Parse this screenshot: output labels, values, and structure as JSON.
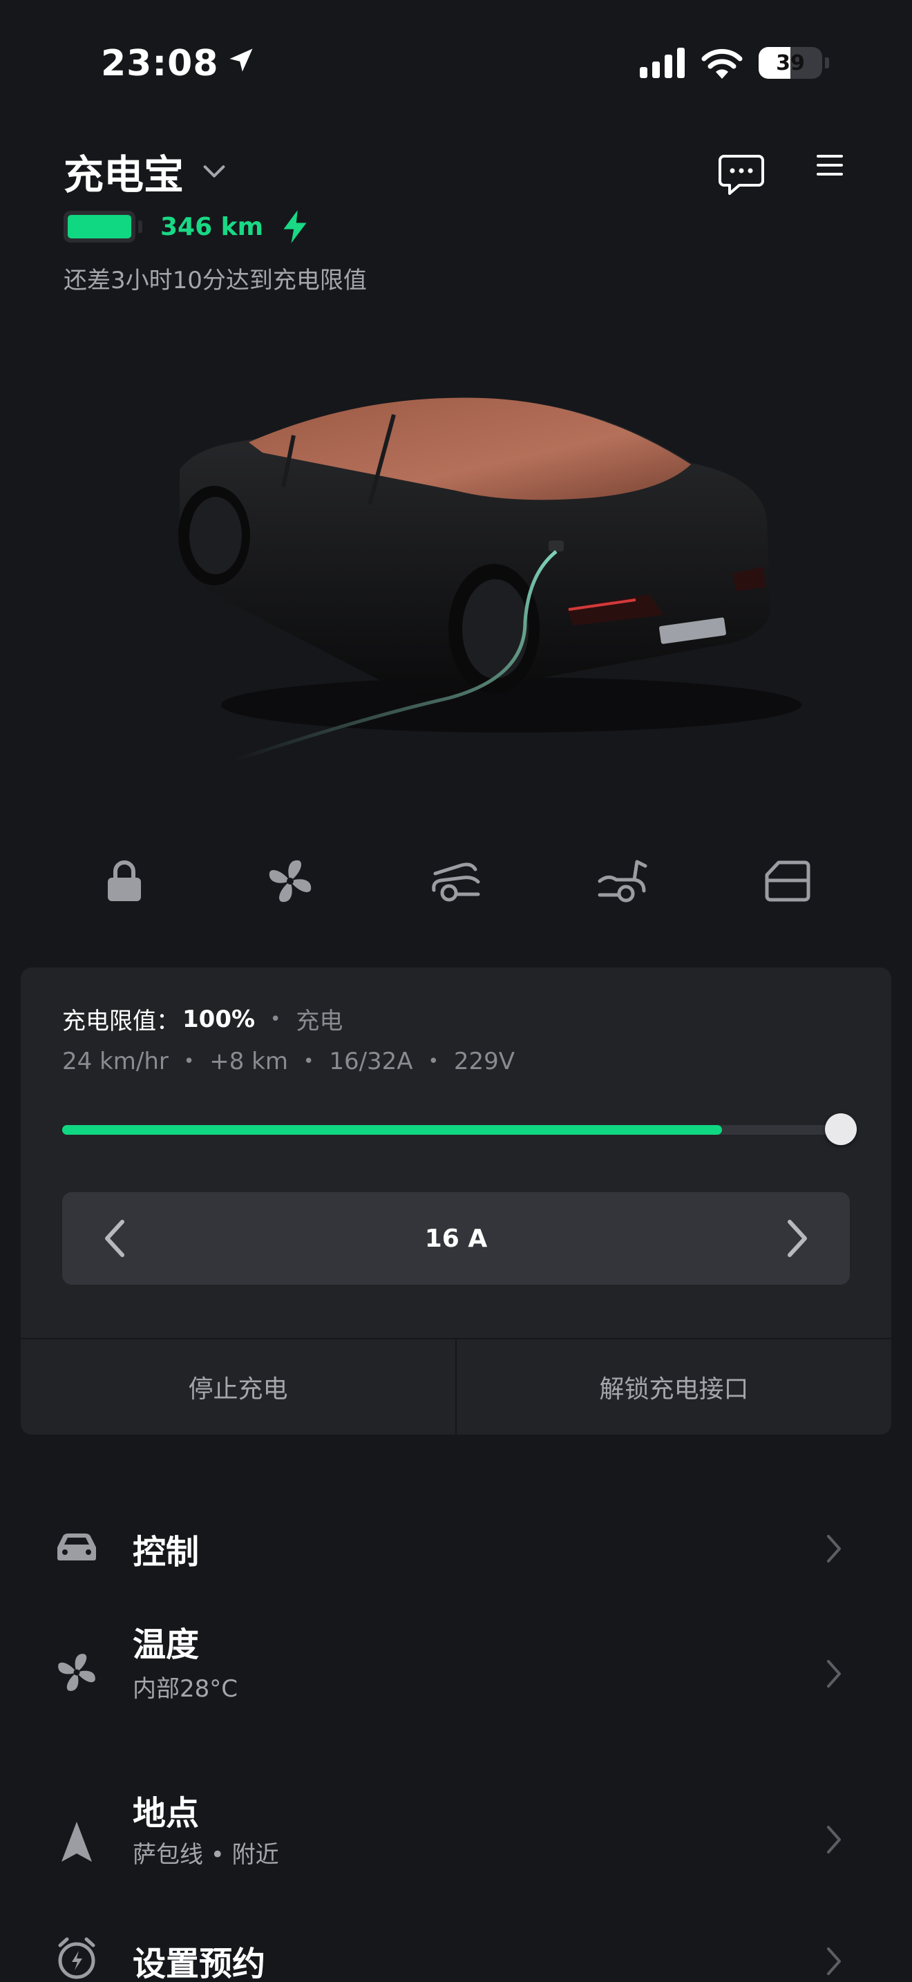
{
  "status_bar": {
    "time": "23:08",
    "battery_percent": "39"
  },
  "header": {
    "car_name": "充电宝",
    "range": "346 km",
    "charge_eta": "还差3小时10分达到充电限值"
  },
  "quick_controls": [
    {
      "icon": "lock-icon"
    },
    {
      "icon": "fan-icon"
    },
    {
      "icon": "frunk-icon"
    },
    {
      "icon": "trunk-icon"
    },
    {
      "icon": "charge-port-icon"
    }
  ],
  "charging": {
    "limit_label": "充电限值：",
    "limit_value": "100%",
    "state": "充电",
    "rate": "24 km/hr",
    "added": "+8 km",
    "current": "16/32A",
    "voltage": "229V",
    "progress_fraction": 0.83,
    "limit_fraction": 1.0,
    "amp_value": "16 A",
    "stop_label": "停止充电",
    "unlock_label": "解锁充电接口"
  },
  "menu": [
    {
      "title": "控制",
      "subtitle": "",
      "icon": "car-icon"
    },
    {
      "title": "温度",
      "subtitle": "内部28°C",
      "icon": "fan-icon"
    },
    {
      "title": "地点",
      "subtitle": "萨包线 • 附近",
      "icon": "location-arrow-icon"
    },
    {
      "title": "设置预约",
      "subtitle": "",
      "icon": "alarm-clock-icon"
    }
  ],
  "colors": {
    "background": "#16171b",
    "card": "#222327",
    "accent_green": "#10d782",
    "muted_text": "#a5a6ab"
  }
}
